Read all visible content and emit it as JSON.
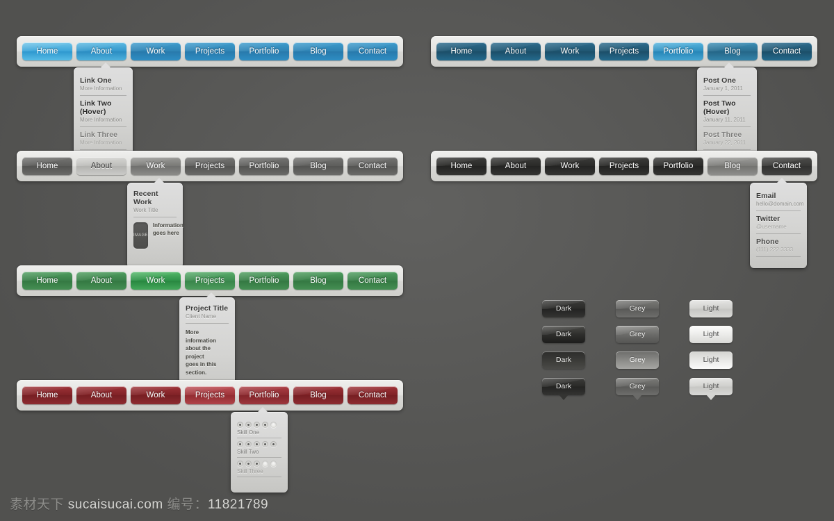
{
  "nav_items": [
    "Home",
    "About",
    "Work",
    "Projects",
    "Portfolio",
    "Blog",
    "Contact"
  ],
  "navbars": [
    {
      "id": "blue-light",
      "theme": "t-blue",
      "active_index": 0,
      "hover_index": 1,
      "items": [
        "Home",
        "About",
        "Work",
        "Projects",
        "Portfolio",
        "Blog",
        "Contact"
      ]
    },
    {
      "id": "blue-dark",
      "theme": "t-blued",
      "active_index": 4,
      "hover_index": 5,
      "items": [
        "Home",
        "About",
        "Work",
        "Projects",
        "Portfolio",
        "Blog",
        "Contact"
      ]
    },
    {
      "id": "grey",
      "theme": "t-grey",
      "active_index": 1,
      "hover_index": 2,
      "items": [
        "Home",
        "About",
        "Work",
        "Projects",
        "Portfolio",
        "Blog",
        "Contact"
      ]
    },
    {
      "id": "dark",
      "theme": "t-dark",
      "active_index": 5,
      "hover_index": 6,
      "items": [
        "Home",
        "About",
        "Work",
        "Projects",
        "Portfolio",
        "Blog",
        "Contact"
      ]
    },
    {
      "id": "green",
      "theme": "t-green",
      "active_index": 2,
      "hover_index": 3,
      "items": [
        "Home",
        "About",
        "Work",
        "Projects",
        "Portfolio",
        "Blog",
        "Contact"
      ]
    },
    {
      "id": "red",
      "theme": "t-red",
      "active_index": 3,
      "hover_index": 4,
      "items": [
        "Home",
        "About",
        "Work",
        "Projects",
        "Portfolio",
        "Blog",
        "Contact"
      ]
    }
  ],
  "popovers": {
    "links": {
      "rows": [
        {
          "title": "Link One",
          "sub": "More Information"
        },
        {
          "title": "Link Two (Hover)",
          "sub": "More Information"
        },
        {
          "title": "Link Three",
          "sub": "More Information"
        }
      ]
    },
    "posts": {
      "rows": [
        {
          "title": "Post One",
          "sub": "January 1, 2011"
        },
        {
          "title": "Post Two (Hover)",
          "sub": "January 11, 2011"
        },
        {
          "title": "Post Three",
          "sub": "January 22, 2011"
        }
      ]
    },
    "recent_work": {
      "title": "Recent Work",
      "sub": "Work Title",
      "image_label": "IMAGE",
      "info_line_1": "Information",
      "info_line_2": "goes here"
    },
    "contact": {
      "rows": [
        {
          "title": "Email",
          "sub": "hello@domain.com"
        },
        {
          "title": "Twitter",
          "sub": "@username"
        },
        {
          "title": "Phone",
          "sub": "(111) 222 3333"
        }
      ]
    },
    "project": {
      "title": "Project Title",
      "sub": "Client Name",
      "body_line_1": "More information",
      "body_line_2": "about the project",
      "body_line_3": "goes in this section."
    },
    "skills": {
      "rows": [
        {
          "label": "Skill One",
          "filled": 4,
          "total": 5
        },
        {
          "label": "Skill Two",
          "filled": 5,
          "total": 5
        },
        {
          "label": "Skill Three",
          "filled": 3,
          "total": 5
        }
      ]
    }
  },
  "sample_buttons": {
    "rows": [
      {
        "style": "flat",
        "labels": [
          "Dark",
          "Grey",
          "Light"
        ]
      },
      {
        "style": "glossy",
        "labels": [
          "Dark",
          "Grey",
          "Light"
        ]
      },
      {
        "style": "inverse",
        "labels": [
          "Dark",
          "Grey",
          "Light"
        ]
      },
      {
        "style": "tooltip",
        "labels": [
          "Dark",
          "Grey",
          "Light"
        ]
      }
    ]
  },
  "watermark": {
    "brand": "素材天下",
    "site": "sucaisucai.com",
    "id_label": "编号：",
    "id_value": "11821789"
  },
  "colors": {
    "page_bg": "#5a5a58",
    "bar_bg": "#e3e3e0",
    "blue": "#2f83b4",
    "blue_active": "#3ba4d8",
    "blue_dark": "#205671",
    "grey": "#5d5d5b",
    "dark": "#2a2a28",
    "green": "#3a8049",
    "green_active": "#2f9249",
    "red": "#7f2226",
    "red_active": "#9c3338",
    "popover_bg": "#d4d4d2"
  }
}
